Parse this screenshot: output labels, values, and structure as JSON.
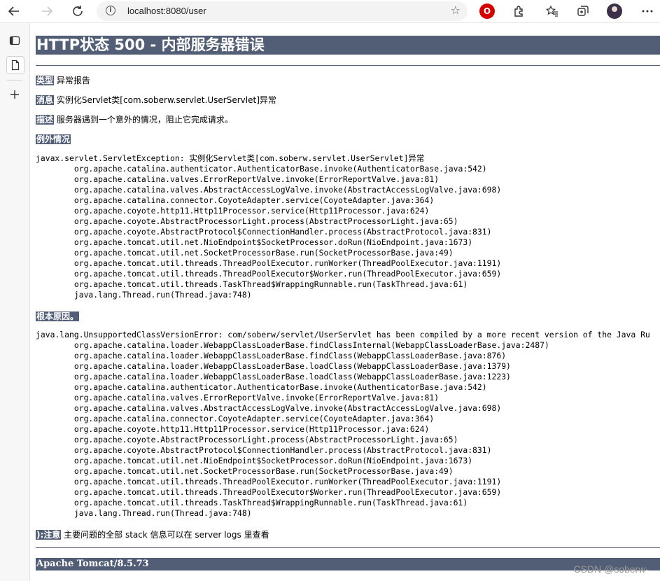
{
  "browser": {
    "url": "localhost:8080/user",
    "ext_label": "O"
  },
  "page": {
    "title": "HTTP状态 500 - 内部服务器错误",
    "type_label": "类型",
    "type_value": "异常报告",
    "message_label": "消息",
    "message_value": "实例化Servlet类[com.soberw.servlet.UserServlet]异常",
    "description_label": "描述",
    "description_value": "服务器遇到一个意外的情况，阻止它完成请求。",
    "exception_heading": "例外情况",
    "exception_trace": [
      "javax.servlet.ServletException: 实例化Servlet类[com.soberw.servlet.UserServlet]异常",
      "\torg.apache.catalina.authenticator.AuthenticatorBase.invoke(AuthenticatorBase.java:542)",
      "\torg.apache.catalina.valves.ErrorReportValve.invoke(ErrorReportValve.java:81)",
      "\torg.apache.catalina.valves.AbstractAccessLogValve.invoke(AbstractAccessLogValve.java:698)",
      "\torg.apache.catalina.connector.CoyoteAdapter.service(CoyoteAdapter.java:364)",
      "\torg.apache.coyote.http11.Http11Processor.service(Http11Processor.java:624)",
      "\torg.apache.coyote.AbstractProcessorLight.process(AbstractProcessorLight.java:65)",
      "\torg.apache.coyote.AbstractProtocol$ConnectionHandler.process(AbstractProtocol.java:831)",
      "\torg.apache.tomcat.util.net.NioEndpoint$SocketProcessor.doRun(NioEndpoint.java:1673)",
      "\torg.apache.tomcat.util.net.SocketProcessorBase.run(SocketProcessorBase.java:49)",
      "\torg.apache.tomcat.util.threads.ThreadPoolExecutor.runWorker(ThreadPoolExecutor.java:1191)",
      "\torg.apache.tomcat.util.threads.ThreadPoolExecutor$Worker.run(ThreadPoolExecutor.java:659)",
      "\torg.apache.tomcat.util.threads.TaskThread$WrappingRunnable.run(TaskThread.java:61)",
      "\tjava.lang.Thread.run(Thread.java:748)"
    ],
    "root_cause_heading": "根本原因。",
    "root_cause_trace": [
      "java.lang.UnsupportedClassVersionError: com/soberw/servlet/UserServlet has been compiled by a more recent version of the Java Ru",
      "\torg.apache.catalina.loader.WebappClassLoaderBase.findClassInternal(WebappClassLoaderBase.java:2487)",
      "\torg.apache.catalina.loader.WebappClassLoaderBase.findClass(WebappClassLoaderBase.java:876)",
      "\torg.apache.catalina.loader.WebappClassLoaderBase.loadClass(WebappClassLoaderBase.java:1379)",
      "\torg.apache.catalina.loader.WebappClassLoaderBase.loadClass(WebappClassLoaderBase.java:1223)",
      "\torg.apache.catalina.authenticator.AuthenticatorBase.invoke(AuthenticatorBase.java:542)",
      "\torg.apache.catalina.valves.ErrorReportValve.invoke(ErrorReportValve.java:81)",
      "\torg.apache.catalina.valves.AbstractAccessLogValve.invoke(AbstractAccessLogValve.java:698)",
      "\torg.apache.catalina.connector.CoyoteAdapter.service(CoyoteAdapter.java:364)",
      "\torg.apache.coyote.http11.Http11Processor.service(Http11Processor.java:624)",
      "\torg.apache.coyote.AbstractProcessorLight.process(AbstractProcessorLight.java:65)",
      "\torg.apache.coyote.AbstractProtocol$ConnectionHandler.process(AbstractProtocol.java:831)",
      "\torg.apache.tomcat.util.net.NioEndpoint$SocketProcessor.doRun(NioEndpoint.java:1673)",
      "\torg.apache.tomcat.util.net.SocketProcessorBase.run(SocketProcessorBase.java:49)",
      "\torg.apache.tomcat.util.threads.ThreadPoolExecutor.runWorker(ThreadPoolExecutor.java:1191)",
      "\torg.apache.tomcat.util.threads.ThreadPoolExecutor$Worker.run(ThreadPoolExecutor.java:659)",
      "\torg.apache.tomcat.util.threads.TaskThread$WrappingRunnable.run(TaskThread.java:61)",
      "\tjava.lang.Thread.run(Thread.java:748)"
    ],
    "note_label": "):注意",
    "note_value": "主要问题的全部 stack 信息可以在 server logs 里查看",
    "footer": "Apache Tomcat/8.5.73"
  },
  "watermark": "CSDN @soberw-"
}
